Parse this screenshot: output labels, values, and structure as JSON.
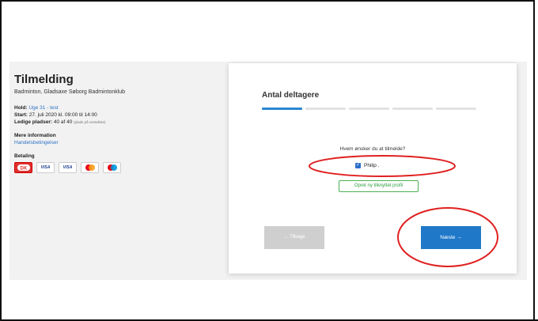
{
  "event": {
    "title": "Tilmelding",
    "subtitle": "Badminton, Gladsaxe Søborg Badmintonklub",
    "hold_label": "Hold:",
    "hold_value": "Uge 31 - test",
    "start_label": "Start:",
    "start_value": "27. juli 2020 kl. 09:00 til 14:00",
    "seats_label": "Ledige pladser:",
    "seats_value": "40 af 40",
    "seats_note": "(plads på venteliste)",
    "more_info_title": "Mere information",
    "terms_link": "Handelsbetingelser",
    "payment_title": "Betaling",
    "payment_cards": [
      {
        "name": "dankort-icon",
        "label": ""
      },
      {
        "name": "visa-icon",
        "label": "VISA"
      },
      {
        "name": "visa-electron-icon",
        "label": "VISA"
      },
      {
        "name": "mastercard-icon",
        "label": ""
      },
      {
        "name": "maestro-icon",
        "label": ""
      }
    ]
  },
  "wizard": {
    "step_title": "Antal deltagere",
    "steps_total": 5,
    "steps_active": 1,
    "question": "Hvem ønsker du at tilmelde?",
    "participant_name": "Philip .",
    "participant_checked": true,
    "create_profile_label": "Opret ny tilknyttet profil",
    "back_label": "← Tilbage",
    "next_label": "Næste →"
  },
  "colors": {
    "accent": "#1f78c8",
    "progress_active": "#2b86d1",
    "link": "#2d72c4",
    "secondary_button": "#cfcfcf",
    "green_button": "#2e9d3e",
    "annotation": "#e02020"
  }
}
